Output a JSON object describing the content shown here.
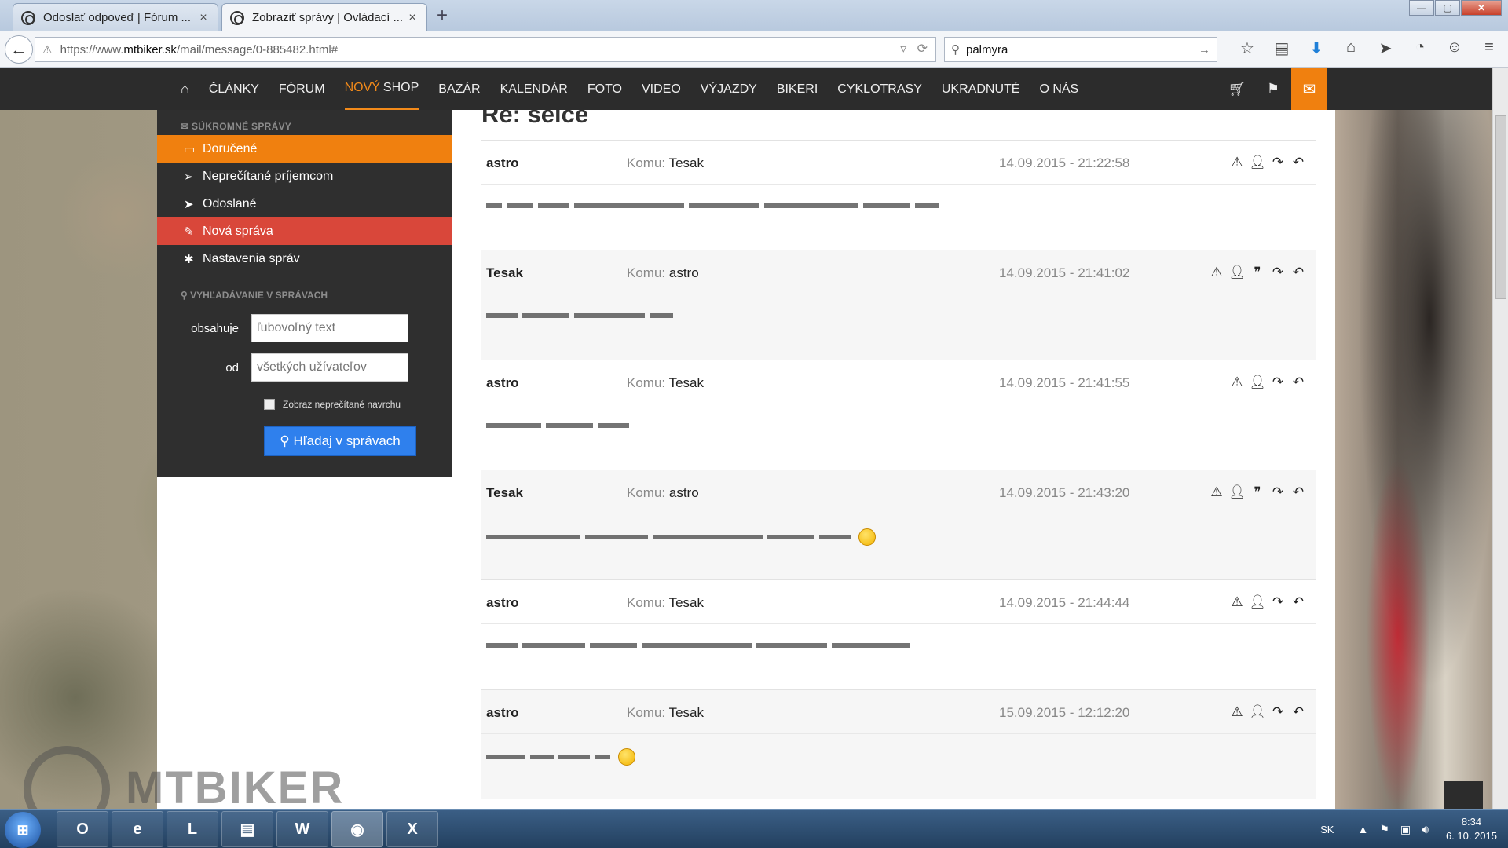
{
  "browser": {
    "tabs": [
      {
        "title": "Odoslať odpoveď | Fórum ..."
      },
      {
        "title": "Zobraziť správy | Ovládací ..."
      }
    ],
    "tab_close": "×",
    "new_tab": "+",
    "url_prefix": "https://www.",
    "url_domain": "mtbiker.sk",
    "url_path": "/mail/message/0-885482.html#",
    "search_value": "palmyra",
    "window_buttons": {
      "minimize": "—",
      "maximize": "▢",
      "close": "✕"
    }
  },
  "site_nav": {
    "home_icon": "home-icon",
    "items": [
      "ČLÁNKY",
      "FÓRUM",
      "BAZÁR",
      "KALENDÁR",
      "FOTO",
      "VIDEO",
      "VÝJAZDY",
      "BIKERI",
      "CYKLOTRASY",
      "UKRADNUTÉ",
      "O NÁS"
    ],
    "shop_prefix": "NOVÝ",
    "shop_label": "SHOP"
  },
  "sidebar": {
    "section_private": "SÚKROMNÉ SPRÁVY",
    "items": [
      {
        "label": "Doručené",
        "icon": "inbox-icon",
        "state": "active"
      },
      {
        "label": "Neprečítané príjemcom",
        "icon": "paper-plane-outline-icon"
      },
      {
        "label": "Odoslané",
        "icon": "paper-plane-icon"
      },
      {
        "label": "Nová správa",
        "icon": "edit-icon",
        "state": "highlight"
      },
      {
        "label": "Nastavenia správ",
        "icon": "gear-icon"
      }
    ],
    "section_search": "VYHĽADÁVANIE V SPRÁVACH",
    "contains_label": "obsahuje",
    "contains_placeholder": "ľubovoľný text",
    "from_label": "od",
    "from_placeholder": "všetkých užívateľov",
    "unread_first_label": "Zobraz neprečítané navrchu",
    "search_button": "Hľadaj v správach"
  },
  "page": {
    "title": "Re: selce",
    "to_label": "Komu:",
    "messages": [
      {
        "from": "astro",
        "to": "Tesak",
        "date": "14.09.2015 - 21:22:58",
        "quote": false,
        "text": "",
        "emoticon": false
      },
      {
        "from": "Tesak",
        "to": "astro",
        "date": "14.09.2015 - 21:41:02",
        "quote": true,
        "text": "",
        "emoticon": false
      },
      {
        "from": "astro",
        "to": "Tesak",
        "date": "14.09.2015 - 21:41:55",
        "quote": false,
        "text": "",
        "emoticon": false
      },
      {
        "from": "Tesak",
        "to": "astro",
        "date": "14.09.2015 - 21:43:20",
        "quote": true,
        "text": "",
        "emoticon": true
      },
      {
        "from": "astro",
        "to": "Tesak",
        "date": "14.09.2015 - 21:44:44",
        "quote": false,
        "text": "",
        "emoticon": false
      },
      {
        "from": "astro",
        "to": "Tesak",
        "date": "15.09.2015 - 12:12:20",
        "quote": false,
        "text": "",
        "emoticon": true
      }
    ]
  },
  "watermark": "MTBIKER",
  "taskbar": {
    "apps": [
      "O",
      "e",
      "L",
      "▤",
      "W",
      "◉",
      "X"
    ],
    "language": "SK",
    "time": "8:34",
    "date": "6. 10. 2015"
  }
}
